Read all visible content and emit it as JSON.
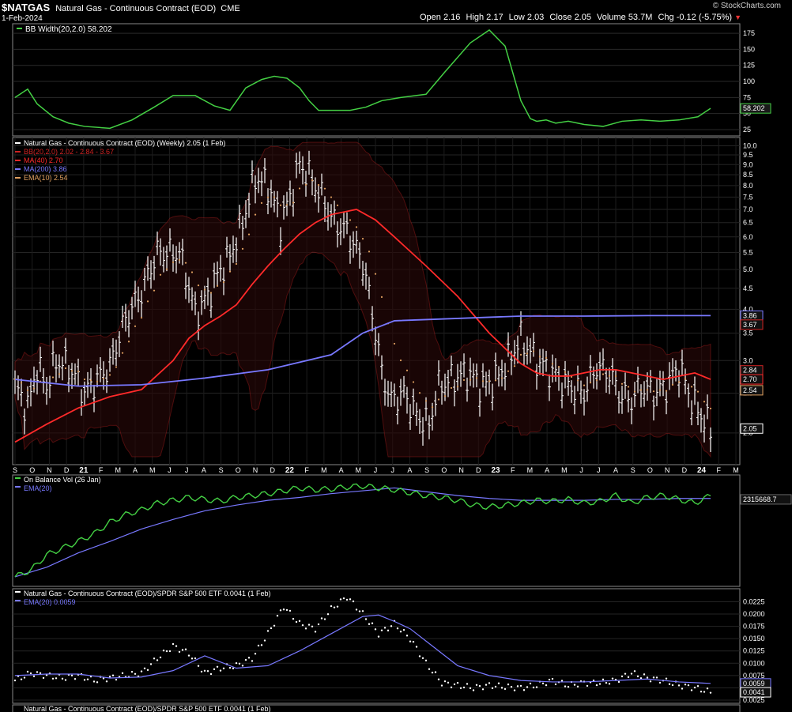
{
  "header": {
    "symbol": "$NATGAS",
    "description": "Natural Gas - Continuous Contract (EOD)",
    "exchange": "CME",
    "date": "1-Feb-2024",
    "watermark": "© StockCharts.com",
    "ohlc": {
      "open_label": "Open",
      "open": "2.16",
      "high_label": "High",
      "high": "2.17",
      "low_label": "Low",
      "low": "2.03",
      "close_label": "Close",
      "close": "2.05",
      "volume_label": "Volume",
      "volume": "53.7M",
      "chg_label": "Chg",
      "chg": "-0.12 (-5.75%)"
    }
  },
  "colors": {
    "background": "#000000",
    "price_bar": "#ffffff",
    "bb": "#cc2222",
    "ma40": "#ff2a2a",
    "ma200": "#7878ff",
    "ema10": "#e0a060",
    "bbwidth": "#44d044",
    "obv": "#44d044",
    "ema20": "#7878ff",
    "ratio_points": "#ffffff"
  },
  "chart_data": [
    {
      "type": "line",
      "panel": "bb-width",
      "legend": "BB Width(20,2.0) 58.202",
      "last_value_label": "58.202",
      "y_ticks": [
        "175",
        "150",
        "125",
        "100",
        "75",
        "50",
        "25"
      ],
      "ylim": [
        25,
        180
      ],
      "series": [
        {
          "name": "BB Width(20,2.0)",
          "x": [
            0,
            4,
            7,
            12,
            17,
            22,
            30,
            37,
            44,
            50,
            57,
            63,
            68,
            73,
            78,
            82,
            86,
            90,
            93,
            96,
            101,
            106,
            111,
            116,
            122,
            130,
            136,
            144,
            150,
            155,
            160,
            163,
            165,
            168,
            171,
            175,
            180,
            186,
            192,
            198,
            204,
            210,
            216,
            220
          ],
          "values": [
            75,
            88,
            65,
            45,
            35,
            30,
            27,
            40,
            60,
            78,
            78,
            62,
            55,
            90,
            103,
            108,
            105,
            90,
            70,
            55,
            55,
            55,
            60,
            70,
            75,
            80,
            115,
            160,
            180,
            155,
            70,
            42,
            38,
            40,
            35,
            38,
            33,
            30,
            38,
            40,
            38,
            40,
            45,
            58
          ]
        }
      ]
    },
    {
      "type": "line",
      "panel": "price",
      "legend": [
        "Natural Gas - Continuous Contract (EOD) (Weekly) 2.05 (1 Feb)",
        "BB(20,2.0) 2.02 - 2.84 - 3.67",
        "MA(40) 2.70",
        "MA(200) 3.86",
        "EMA(10) 2.54"
      ],
      "scale": "log",
      "y_ticks": [
        "10.0",
        "9.5",
        "9.0",
        "8.5",
        "8.0",
        "7.5",
        "7.0",
        "6.5",
        "6.0",
        "5.5",
        "5.0",
        "4.5",
        "4.0",
        "3.5",
        "3.0",
        "2.5",
        "2.0"
      ],
      "ylim": [
        1.75,
        10.2
      ],
      "x_tick_labels": [
        "S",
        "O",
        "N",
        "D",
        "21",
        "F",
        "M",
        "A",
        "M",
        "J",
        "J",
        "A",
        "S",
        "O",
        "N",
        "D",
        "22",
        "F",
        "M",
        "A",
        "M",
        "J",
        "J",
        "A",
        "S",
        "O",
        "N",
        "D",
        "23",
        "F",
        "M",
        "A",
        "M",
        "J",
        "J",
        "A",
        "S",
        "O",
        "N",
        "D",
        "24",
        "F",
        "M"
      ],
      "value_badges": [
        {
          "label": "3.86",
          "value": 3.86,
          "color": "#7878ff"
        },
        {
          "label": "3.67",
          "value": 3.67,
          "color": "#cc2222"
        },
        {
          "label": "2.84",
          "value": 2.84,
          "color": "#cc2222"
        },
        {
          "label": "2.70",
          "value": 2.7,
          "color": "#ff2a2a"
        },
        {
          "label": "2.54",
          "value": 2.54,
          "color": "#e0a060"
        },
        {
          "label": "2.05",
          "value": 2.05,
          "color": "#ffffff"
        }
      ],
      "close_anchors": {
        "x": [
          0,
          4,
          7,
          10,
          13,
          17,
          22,
          26,
          30,
          35,
          40,
          45,
          52,
          57,
          61,
          65,
          68,
          72,
          76,
          80,
          84,
          87,
          90,
          93,
          97,
          101,
          105,
          110,
          113,
          116,
          119,
          123,
          127,
          131,
          134,
          138,
          143,
          148,
          152,
          156,
          160,
          165,
          170,
          175,
          180,
          184,
          188,
          191,
          195,
          198,
          202,
          206,
          210,
          214,
          218,
          220
        ],
        "values": [
          2.6,
          2.3,
          2.9,
          2.6,
          3.0,
          2.9,
          2.5,
          2.7,
          2.9,
          3.8,
          4.4,
          5.5,
          5.5,
          3.9,
          4.3,
          5.0,
          5.4,
          6.5,
          8.4,
          8.0,
          6.5,
          7.5,
          9.0,
          8.5,
          7.5,
          6.5,
          6.2,
          5.2,
          3.9,
          2.8,
          2.4,
          2.5,
          2.2,
          2.1,
          2.6,
          2.7,
          2.8,
          2.6,
          2.7,
          3.0,
          3.4,
          3.0,
          2.8,
          2.6,
          2.5,
          2.9,
          2.8,
          2.5,
          2.4,
          2.6,
          2.5,
          2.6,
          2.9,
          2.4,
          2.15,
          2.05
        ]
      },
      "series": [
        {
          "name": "MA(40)",
          "x": [
            0,
            10,
            20,
            30,
            40,
            50,
            55,
            60,
            65,
            70,
            75,
            80,
            85,
            90,
            95,
            100,
            108,
            114,
            120,
            130,
            140,
            150,
            160,
            165,
            170,
            175,
            180,
            185,
            190,
            195,
            200,
            205,
            210,
            215,
            220
          ],
          "values": [
            1.9,
            2.1,
            2.3,
            2.45,
            2.55,
            3.0,
            3.4,
            3.65,
            3.85,
            4.1,
            4.6,
            5.1,
            5.6,
            6.1,
            6.5,
            6.8,
            7.0,
            6.6,
            6.0,
            5.1,
            4.3,
            3.5,
            2.95,
            2.8,
            2.75,
            2.75,
            2.8,
            2.85,
            2.85,
            2.8,
            2.75,
            2.7,
            2.75,
            2.8,
            2.7
          ]
        },
        {
          "name": "MA(200)",
          "x": [
            0,
            20,
            40,
            60,
            80,
            100,
            110,
            120,
            140,
            160,
            180,
            200,
            220
          ],
          "values": [
            2.7,
            2.6,
            2.62,
            2.72,
            2.85,
            3.1,
            3.5,
            3.75,
            3.8,
            3.85,
            3.85,
            3.86,
            3.86
          ]
        }
      ]
    },
    {
      "type": "line",
      "panel": "on-balance-volume",
      "legend": [
        "On Balance Vol (26 Jan)",
        "EMA(20)"
      ],
      "last_value_label": "2315668.7",
      "series": [
        {
          "name": "On Balance Vol",
          "x": [
            0,
            5,
            10,
            15,
            20,
            25,
            30,
            35,
            40,
            45,
            50,
            55,
            60,
            65,
            70,
            75,
            80,
            85,
            90,
            95,
            100,
            105,
            110,
            115,
            120,
            125,
            130,
            135,
            140,
            145,
            150,
            155,
            160,
            165,
            170,
            175,
            180,
            185,
            190,
            195,
            200,
            205,
            210,
            215,
            220
          ],
          "values": [
            0.05,
            0.12,
            0.28,
            0.35,
            0.42,
            0.5,
            0.62,
            0.7,
            0.75,
            0.82,
            0.85,
            0.88,
            0.86,
            0.84,
            0.88,
            0.9,
            0.92,
            0.95,
            0.98,
            0.96,
            0.97,
            0.99,
            1.0,
            0.98,
            0.96,
            0.93,
            0.9,
            0.88,
            0.85,
            0.8,
            0.78,
            0.8,
            0.82,
            0.85,
            0.84,
            0.86,
            0.82,
            0.84,
            0.9,
            0.82,
            0.88,
            0.9,
            0.86,
            0.82,
            0.9
          ]
        },
        {
          "name": "EMA(20)",
          "x": [
            0,
            10,
            20,
            30,
            40,
            50,
            60,
            70,
            80,
            90,
            100,
            110,
            120,
            130,
            140,
            150,
            160,
            170,
            180,
            190,
            200,
            210,
            220
          ],
          "values": [
            0.05,
            0.15,
            0.3,
            0.42,
            0.55,
            0.65,
            0.74,
            0.8,
            0.85,
            0.88,
            0.92,
            0.95,
            0.98,
            0.94,
            0.9,
            0.87,
            0.85,
            0.85,
            0.85,
            0.86,
            0.86,
            0.87,
            0.87
          ]
        }
      ]
    },
    {
      "type": "scatter",
      "panel": "ratio",
      "legend": [
        "Natural Gas - Continuous Contract (EOD)/SPDR S&P 500 ETF 0.0041 (1 Feb)",
        "EMA(20) 0.0059"
      ],
      "y_ticks": [
        "0.0225",
        "0.0200",
        "0.0175",
        "0.0150",
        "0.0125",
        "0.0100",
        "0.0075",
        "0.0050",
        "0.0025"
      ],
      "ylim": [
        0.0025,
        0.0245
      ],
      "value_badges": [
        {
          "label": "0.0059",
          "value": 0.0059,
          "color": "#7878ff"
        },
        {
          "label": "0.0041",
          "value": 0.0041,
          "color": "#ffffff"
        }
      ],
      "series": [
        {
          "name": "Ratio",
          "x": [
            0,
            5,
            10,
            15,
            20,
            25,
            30,
            35,
            40,
            45,
            50,
            55,
            60,
            65,
            70,
            75,
            80,
            85,
            90,
            95,
            100,
            105,
            110,
            115,
            120,
            125,
            130,
            135,
            140,
            145,
            150,
            155,
            160,
            165,
            170,
            175,
            180,
            185,
            190,
            195,
            200,
            205,
            210,
            215,
            220
          ],
          "values": [
            0.0065,
            0.008,
            0.0075,
            0.007,
            0.0075,
            0.0065,
            0.007,
            0.0075,
            0.008,
            0.011,
            0.0135,
            0.012,
            0.008,
            0.009,
            0.0095,
            0.011,
            0.016,
            0.0215,
            0.018,
            0.017,
            0.021,
            0.0235,
            0.02,
            0.016,
            0.018,
            0.015,
            0.01,
            0.006,
            0.0055,
            0.005,
            0.0055,
            0.0052,
            0.005,
            0.0055,
            0.0065,
            0.0055,
            0.006,
            0.006,
            0.0065,
            0.008,
            0.007,
            0.0065,
            0.0055,
            0.005,
            0.0041
          ]
        },
        {
          "name": "EMA(20)",
          "x": [
            0,
            10,
            20,
            30,
            40,
            50,
            60,
            70,
            80,
            90,
            100,
            110,
            115,
            120,
            125,
            130,
            140,
            150,
            160,
            170,
            180,
            190,
            200,
            210,
            220
          ],
          "values": [
            0.0075,
            0.0078,
            0.0078,
            0.007,
            0.0072,
            0.0085,
            0.0115,
            0.009,
            0.0095,
            0.0125,
            0.016,
            0.0195,
            0.0198,
            0.0185,
            0.017,
            0.0145,
            0.0095,
            0.0075,
            0.0065,
            0.0062,
            0.0062,
            0.0065,
            0.0068,
            0.0062,
            0.0059
          ]
        }
      ]
    }
  ]
}
